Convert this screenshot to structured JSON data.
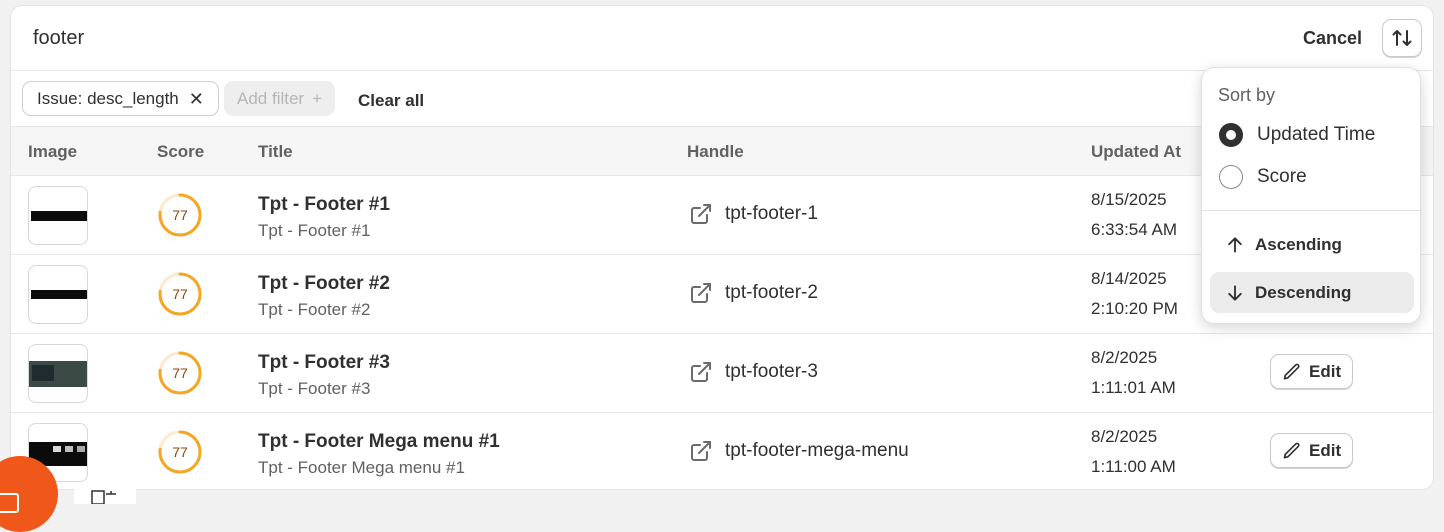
{
  "search": {
    "value": "footer",
    "cancel_label": "Cancel"
  },
  "filters": {
    "chip_label": "Issue: desc_length",
    "add_filter_label": "Add filter",
    "clear_all_label": "Clear all"
  },
  "table": {
    "headers": {
      "image": "Image",
      "score": "Score",
      "title": "Title",
      "handle": "Handle",
      "updated_at": "Updated At"
    },
    "rows": [
      {
        "score": "77",
        "title": "Tpt - Footer #1",
        "subtitle": "Tpt - Footer #1",
        "handle": "tpt-footer-1",
        "date": "8/15/2025",
        "time": "6:33:54 AM"
      },
      {
        "score": "77",
        "title": "Tpt - Footer #2",
        "subtitle": "Tpt - Footer #2",
        "handle": "tpt-footer-2",
        "date": "8/14/2025",
        "time": "2:10:20 PM"
      },
      {
        "score": "77",
        "title": "Tpt - Footer #3",
        "subtitle": "Tpt - Footer #3",
        "handle": "tpt-footer-3",
        "date": "8/2/2025",
        "time": "1:11:01 AM",
        "edit_label": "Edit"
      },
      {
        "score": "77",
        "title": "Tpt - Footer Mega menu #1",
        "subtitle": "Tpt - Footer Mega menu #1",
        "handle": "tpt-footer-mega-menu",
        "date": "8/2/2025",
        "time": "1:11:00 AM",
        "edit_label": "Edit"
      }
    ]
  },
  "sort_popover": {
    "title": "Sort by",
    "options": [
      "Updated Time",
      "Score"
    ],
    "selected_option": "Updated Time",
    "directions": [
      "Ascending",
      "Descending"
    ],
    "selected_direction": "Descending"
  },
  "colors": {
    "score_ring": "#f5a623",
    "fab": "#f0571b",
    "active_row": "#ebebeb"
  },
  "icons": {
    "sort": "sort-arrows-icon",
    "external_link": "external-link-icon",
    "edit": "pencil-icon",
    "close": "close-icon",
    "plus": "plus-icon"
  }
}
